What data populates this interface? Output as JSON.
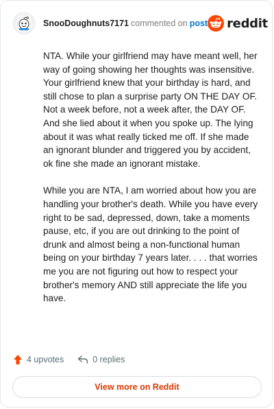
{
  "header": {
    "username": "SnooDoughnuts7171",
    "action_text": "commented on",
    "post_link": "post",
    "brand": "reddit"
  },
  "comment": {
    "paragraphs": [
      "NTA. While your girlfriend may have meant well, her way of going showing her thoughts was insensitive. Your girlfriend knew that your birthday is hard, and still chose to plan a surprise party ON THE DAY OF. Not a week before, not a week after, the DAY OF. And she lied about it when you spoke up. The lying about it was what really ticked me off. If she made an ignorant blunder and triggered you by accident, ok fine she made an ignorant mistake.",
      "While you are NTA, I am worried about how you are handling your brother's death. While you have every right to be sad, depressed, down, take a moments pause, etc, if you are out drinking to the point of drunk and almost being a non-functional human being on your birthday 7 years later. . . . that worries me you are not figuring out how to respect your brother's memory AND still appreciate the life you have."
    ]
  },
  "footer": {
    "upvotes": "4 upvotes",
    "replies": "0 replies",
    "view_button": "View more on Reddit"
  },
  "colors": {
    "upvote": "#ff4500",
    "link": "#0079d3",
    "view_button_text": "#d93900"
  }
}
